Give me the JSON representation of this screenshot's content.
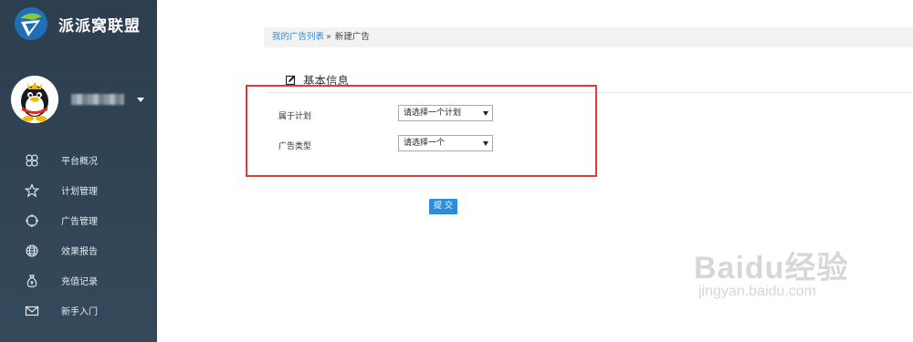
{
  "brand": {
    "name": "派派窝联盟"
  },
  "sidebar": {
    "items": [
      {
        "label": "平台概况",
        "icon": "dashboard-icon"
      },
      {
        "label": "计划管理",
        "icon": "star-icon"
      },
      {
        "label": "广告管理",
        "icon": "target-icon"
      },
      {
        "label": "效果报告",
        "icon": "globe-icon"
      },
      {
        "label": "充值记录",
        "icon": "money-bag-icon"
      },
      {
        "label": "新手入门",
        "icon": "mail-icon"
      }
    ]
  },
  "breadcrumb": {
    "link": "我的广告列表",
    "separator": "»",
    "current": "新建广告"
  },
  "section": {
    "title": "基本信息"
  },
  "form": {
    "plan": {
      "label": "属于计划",
      "value": "请选择一个计划"
    },
    "ad_type": {
      "label": "广告类型",
      "value": "请选择一个"
    },
    "submit_label": "提 交"
  },
  "watermark": {
    "line1": "Baidu经验",
    "line2": "jingyan.baidu.com"
  },
  "colors": {
    "sidebar_bg": "#2d3e4e",
    "accent": "#2d8cdc",
    "highlight_box": "#e53935",
    "link": "#3a87c8"
  }
}
